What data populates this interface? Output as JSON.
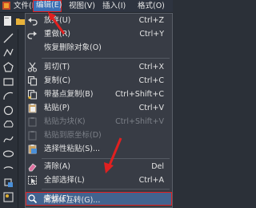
{
  "menubar": {
    "file": "文件(F)",
    "edit": "编辑(E)",
    "view": "视图(V)",
    "insert": "插入(I)",
    "format": "格式(O)"
  },
  "edit_menu": {
    "undo": {
      "label": "放弃(U)",
      "shortcut": "Ctrl+Z"
    },
    "redo": {
      "label": "重做(R)",
      "shortcut": "Ctrl+Y"
    },
    "restore": {
      "label": "恢复删除对象(O)",
      "shortcut": ""
    },
    "cut": {
      "label": "剪切(T)",
      "shortcut": "Ctrl+X"
    },
    "copy": {
      "label": "复制(C)",
      "shortcut": "Ctrl+C"
    },
    "copy_base": {
      "label": "带基点复制(B)",
      "shortcut": "Ctrl+Shift+C"
    },
    "paste": {
      "label": "粘贴(P)",
      "shortcut": "Ctrl+V"
    },
    "paste_block": {
      "label": "粘贴为块(K)",
      "shortcut": "Ctrl+Shift+V"
    },
    "paste_orig": {
      "label": "粘贴到原坐标(D)",
      "shortcut": ""
    },
    "paste_spec": {
      "label": "选择性粘贴(S)...",
      "shortcut": ""
    },
    "delete": {
      "label": "清除(A)",
      "shortcut": "Del"
    },
    "select_all": {
      "label": "全部选择(L)",
      "shortcut": "Ctrl+A"
    },
    "find": {
      "label": "查找(F)...",
      "shortcut": ""
    },
    "convert": {
      "label": "简繁体互转(G)...",
      "shortcut": ""
    }
  },
  "colors": {
    "highlight": "#3a6fb5",
    "annotation": "#e02020",
    "menu_bg": "#383c45"
  }
}
